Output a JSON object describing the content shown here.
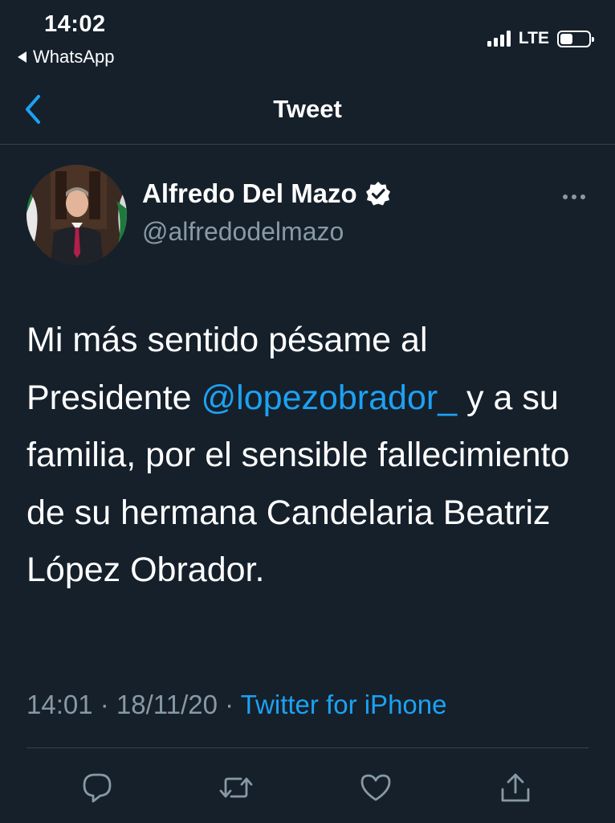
{
  "status_bar": {
    "time": "14:02",
    "back_app": "WhatsApp",
    "network": "LTE",
    "signal_bars": 4,
    "battery_level": 0.45
  },
  "header": {
    "title": "Tweet",
    "back_icon": "chevron-left-icon"
  },
  "tweet": {
    "author": {
      "name": "Alfredo Del Mazo",
      "handle": "@alfredodelmazo",
      "verified": true
    },
    "text_before_mention": "Mi más sentido pésame al Presidente ",
    "mention": "@lopezobrador_",
    "text_after_mention": " y a su familia, por el sensible fallecimiento de su hermana Candelaria Beatriz López Obrador.",
    "time": "14:01",
    "separator": "·",
    "date": "18/11/20",
    "source": "Twitter for iPhone"
  },
  "actions": [
    {
      "name": "reply",
      "icon": "reply-icon"
    },
    {
      "name": "retweet",
      "icon": "retweet-icon"
    },
    {
      "name": "like",
      "icon": "heart-icon"
    },
    {
      "name": "share",
      "icon": "share-icon"
    }
  ],
  "colors": {
    "background": "#15202b",
    "accent": "#1da1f2",
    "secondary_text": "#8899a6",
    "divider": "#38444d"
  }
}
